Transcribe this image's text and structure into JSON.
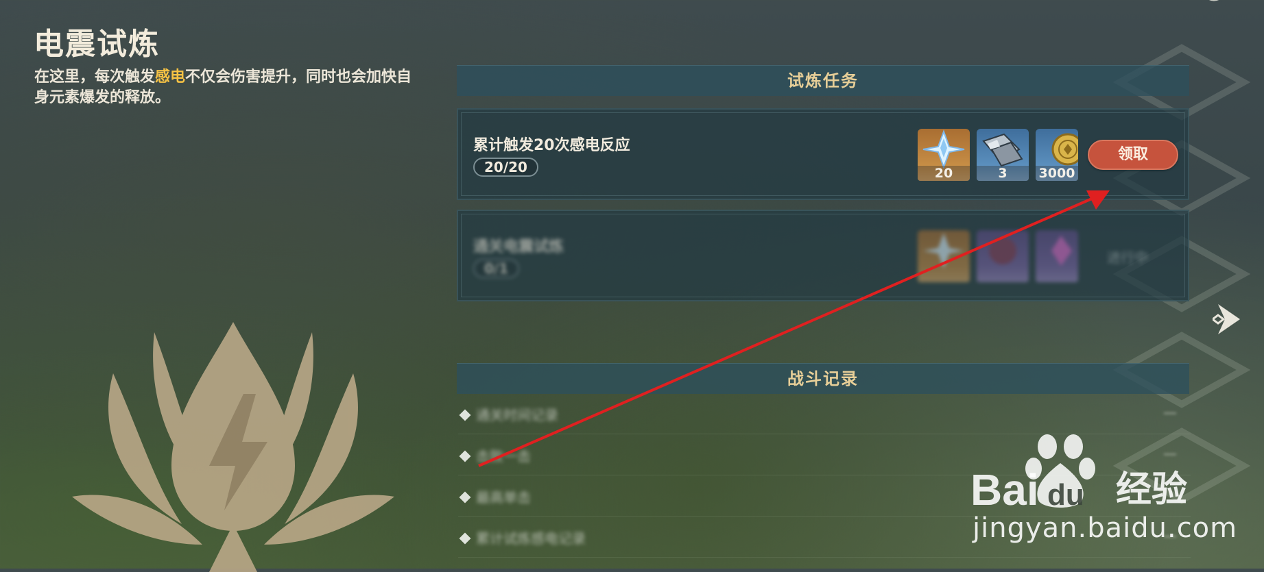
{
  "page": {
    "title": "电震试炼",
    "description_part1": "在这里，每次触发",
    "description_highlight": "感电",
    "description_part2": "不仅会伤害提升，同时也会加快自身元素爆发的释放。"
  },
  "quests_section": {
    "header": "试炼任务",
    "items": [
      {
        "name": "累计触发20次感电反应",
        "progress": "20/20",
        "rewards": [
          {
            "icon": "primogem-icon",
            "count": "20",
            "color": "#c68d45"
          },
          {
            "icon": "mystic-enhancement-ore-icon",
            "count": "3",
            "color": "#5b8fbd"
          },
          {
            "icon": "mora-coin-icon",
            "count": "3000",
            "color": "#5b8fbd"
          }
        ],
        "action_label": "领取",
        "action_color": "#c6533d"
      },
      {
        "name": "通关电震试炼",
        "progress": "0/1",
        "rewards": [
          {
            "icon": "primogem-icon",
            "count": "",
            "color": "#c68d45"
          },
          {
            "icon": "weapon-material-icon",
            "count": "",
            "color": "#7b64a8"
          },
          {
            "icon": "crystal-material-icon",
            "count": "",
            "color": "#7b64a8"
          }
        ],
        "action_label": "进行中"
      }
    ]
  },
  "records_section": {
    "header": "战斗记录",
    "items": [
      {
        "label": "通关时间记录",
        "value": "—"
      },
      {
        "label": "击败一击",
        "value": "—"
      },
      {
        "label": "最高单击",
        "value": ""
      },
      {
        "label": "累计试炼感电记录",
        "value": "—"
      }
    ]
  },
  "watermark": {
    "brand": "Bai du 经验",
    "url": "jingyan.baidu.com"
  },
  "colors": {
    "highlight": "#f6c244",
    "section_header_text": "#e8cf98",
    "claim_button": "#c6533d",
    "annotation_arrow": "#e02020"
  }
}
